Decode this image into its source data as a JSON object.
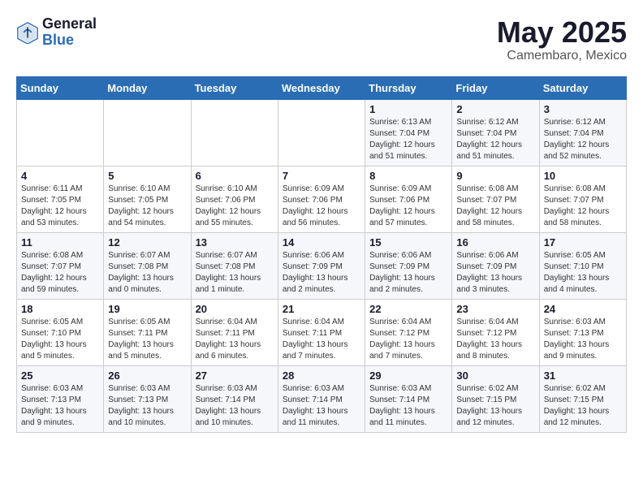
{
  "header": {
    "logo_general": "General",
    "logo_blue": "Blue",
    "month_title": "May 2025",
    "location": "Camembaro, Mexico"
  },
  "weekdays": [
    "Sunday",
    "Monday",
    "Tuesday",
    "Wednesday",
    "Thursday",
    "Friday",
    "Saturday"
  ],
  "weeks": [
    [
      {
        "day": "",
        "sunrise": "",
        "sunset": "",
        "daylight": ""
      },
      {
        "day": "",
        "sunrise": "",
        "sunset": "",
        "daylight": ""
      },
      {
        "day": "",
        "sunrise": "",
        "sunset": "",
        "daylight": ""
      },
      {
        "day": "",
        "sunrise": "",
        "sunset": "",
        "daylight": ""
      },
      {
        "day": "1",
        "sunrise": "Sunrise: 6:13 AM",
        "sunset": "Sunset: 7:04 PM",
        "daylight": "Daylight: 12 hours and 51 minutes."
      },
      {
        "day": "2",
        "sunrise": "Sunrise: 6:12 AM",
        "sunset": "Sunset: 7:04 PM",
        "daylight": "Daylight: 12 hours and 51 minutes."
      },
      {
        "day": "3",
        "sunrise": "Sunrise: 6:12 AM",
        "sunset": "Sunset: 7:04 PM",
        "daylight": "Daylight: 12 hours and 52 minutes."
      }
    ],
    [
      {
        "day": "4",
        "sunrise": "Sunrise: 6:11 AM",
        "sunset": "Sunset: 7:05 PM",
        "daylight": "Daylight: 12 hours and 53 minutes."
      },
      {
        "day": "5",
        "sunrise": "Sunrise: 6:10 AM",
        "sunset": "Sunset: 7:05 PM",
        "daylight": "Daylight: 12 hours and 54 minutes."
      },
      {
        "day": "6",
        "sunrise": "Sunrise: 6:10 AM",
        "sunset": "Sunset: 7:06 PM",
        "daylight": "Daylight: 12 hours and 55 minutes."
      },
      {
        "day": "7",
        "sunrise": "Sunrise: 6:09 AM",
        "sunset": "Sunset: 7:06 PM",
        "daylight": "Daylight: 12 hours and 56 minutes."
      },
      {
        "day": "8",
        "sunrise": "Sunrise: 6:09 AM",
        "sunset": "Sunset: 7:06 PM",
        "daylight": "Daylight: 12 hours and 57 minutes."
      },
      {
        "day": "9",
        "sunrise": "Sunrise: 6:08 AM",
        "sunset": "Sunset: 7:07 PM",
        "daylight": "Daylight: 12 hours and 58 minutes."
      },
      {
        "day": "10",
        "sunrise": "Sunrise: 6:08 AM",
        "sunset": "Sunset: 7:07 PM",
        "daylight": "Daylight: 12 hours and 58 minutes."
      }
    ],
    [
      {
        "day": "11",
        "sunrise": "Sunrise: 6:08 AM",
        "sunset": "Sunset: 7:07 PM",
        "daylight": "Daylight: 12 hours and 59 minutes."
      },
      {
        "day": "12",
        "sunrise": "Sunrise: 6:07 AM",
        "sunset": "Sunset: 7:08 PM",
        "daylight": "Daylight: 13 hours and 0 minutes."
      },
      {
        "day": "13",
        "sunrise": "Sunrise: 6:07 AM",
        "sunset": "Sunset: 7:08 PM",
        "daylight": "Daylight: 13 hours and 1 minute."
      },
      {
        "day": "14",
        "sunrise": "Sunrise: 6:06 AM",
        "sunset": "Sunset: 7:09 PM",
        "daylight": "Daylight: 13 hours and 2 minutes."
      },
      {
        "day": "15",
        "sunrise": "Sunrise: 6:06 AM",
        "sunset": "Sunset: 7:09 PM",
        "daylight": "Daylight: 13 hours and 2 minutes."
      },
      {
        "day": "16",
        "sunrise": "Sunrise: 6:06 AM",
        "sunset": "Sunset: 7:09 PM",
        "daylight": "Daylight: 13 hours and 3 minutes."
      },
      {
        "day": "17",
        "sunrise": "Sunrise: 6:05 AM",
        "sunset": "Sunset: 7:10 PM",
        "daylight": "Daylight: 13 hours and 4 minutes."
      }
    ],
    [
      {
        "day": "18",
        "sunrise": "Sunrise: 6:05 AM",
        "sunset": "Sunset: 7:10 PM",
        "daylight": "Daylight: 13 hours and 5 minutes."
      },
      {
        "day": "19",
        "sunrise": "Sunrise: 6:05 AM",
        "sunset": "Sunset: 7:11 PM",
        "daylight": "Daylight: 13 hours and 5 minutes."
      },
      {
        "day": "20",
        "sunrise": "Sunrise: 6:04 AM",
        "sunset": "Sunset: 7:11 PM",
        "daylight": "Daylight: 13 hours and 6 minutes."
      },
      {
        "day": "21",
        "sunrise": "Sunrise: 6:04 AM",
        "sunset": "Sunset: 7:11 PM",
        "daylight": "Daylight: 13 hours and 7 minutes."
      },
      {
        "day": "22",
        "sunrise": "Sunrise: 6:04 AM",
        "sunset": "Sunset: 7:12 PM",
        "daylight": "Daylight: 13 hours and 7 minutes."
      },
      {
        "day": "23",
        "sunrise": "Sunrise: 6:04 AM",
        "sunset": "Sunset: 7:12 PM",
        "daylight": "Daylight: 13 hours and 8 minutes."
      },
      {
        "day": "24",
        "sunrise": "Sunrise: 6:03 AM",
        "sunset": "Sunset: 7:13 PM",
        "daylight": "Daylight: 13 hours and 9 minutes."
      }
    ],
    [
      {
        "day": "25",
        "sunrise": "Sunrise: 6:03 AM",
        "sunset": "Sunset: 7:13 PM",
        "daylight": "Daylight: 13 hours and 9 minutes."
      },
      {
        "day": "26",
        "sunrise": "Sunrise: 6:03 AM",
        "sunset": "Sunset: 7:13 PM",
        "daylight": "Daylight: 13 hours and 10 minutes."
      },
      {
        "day": "27",
        "sunrise": "Sunrise: 6:03 AM",
        "sunset": "Sunset: 7:14 PM",
        "daylight": "Daylight: 13 hours and 10 minutes."
      },
      {
        "day": "28",
        "sunrise": "Sunrise: 6:03 AM",
        "sunset": "Sunset: 7:14 PM",
        "daylight": "Daylight: 13 hours and 11 minutes."
      },
      {
        "day": "29",
        "sunrise": "Sunrise: 6:03 AM",
        "sunset": "Sunset: 7:14 PM",
        "daylight": "Daylight: 13 hours and 11 minutes."
      },
      {
        "day": "30",
        "sunrise": "Sunrise: 6:02 AM",
        "sunset": "Sunset: 7:15 PM",
        "daylight": "Daylight: 13 hours and 12 minutes."
      },
      {
        "day": "31",
        "sunrise": "Sunrise: 6:02 AM",
        "sunset": "Sunset: 7:15 PM",
        "daylight": "Daylight: 13 hours and 12 minutes."
      }
    ]
  ]
}
